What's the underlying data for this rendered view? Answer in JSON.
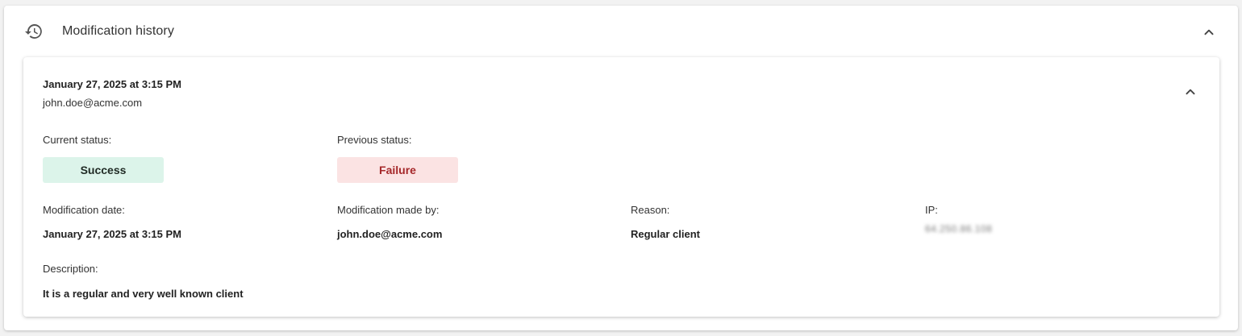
{
  "panel": {
    "title": "Modification history",
    "icon": "history-icon",
    "collapse_icon": "chevron-up-icon"
  },
  "entry": {
    "date": "January 27, 2025 at 3:15 PM",
    "user": "john.doe@acme.com",
    "collapse_icon": "chevron-up-icon",
    "current_status": {
      "label": "Current status:",
      "value": "Success",
      "color": "#dcf4ea"
    },
    "previous_status": {
      "label": "Previous status:",
      "value": "Failure",
      "color": "#fbe3e3",
      "text_color": "#a5282a"
    },
    "modification_date": {
      "label": "Modification date:",
      "value": "January 27, 2025 at 3:15 PM"
    },
    "modified_by": {
      "label": "Modification made by:",
      "value": "john.doe@acme.com"
    },
    "reason": {
      "label": "Reason:",
      "value": "Regular client"
    },
    "ip": {
      "label": "IP:",
      "value": "64.250.86.108"
    },
    "description": {
      "label": "Description:",
      "value": "It is a regular and very well known client"
    }
  }
}
